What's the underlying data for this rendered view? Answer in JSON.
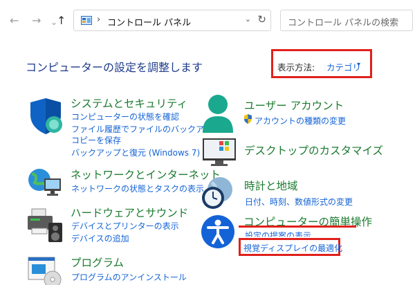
{
  "nav": {
    "back": "←",
    "forward": "→",
    "recent": "⌄",
    "up": "↑"
  },
  "address": {
    "chevron": "›",
    "path": "コントロール パネル",
    "dropdown": "⌄",
    "refresh": "↻"
  },
  "search": {
    "placeholder": "コントロール パネルの検索"
  },
  "heading": "コンピューターの設定を調整します",
  "view": {
    "label": "表示方法:",
    "value": "カテゴリ",
    "caret": "▾",
    "highlight_color": "#e0201b"
  },
  "left": [
    {
      "title": "システムとセキュリティ",
      "icon": "shield-icon",
      "links": [
        "コンピューターの状態を確認",
        "ファイル履歴でファイルのバックアップ",
        "コピーを保存",
        "バックアップと復元 (Windows 7)"
      ]
    },
    {
      "title": "ネットワークとインターネット",
      "icon": "network-globe-icon",
      "links": [
        "ネットワークの状態とタスクの表示"
      ]
    },
    {
      "title": "ハードウェアとサウンド",
      "icon": "printer-speaker-icon",
      "links": [
        "デバイスとプリンターの表示",
        "デバイスの追加"
      ]
    },
    {
      "title": "プログラム",
      "icon": "programs-disc-icon",
      "links": [
        "プログラムのアンインストール"
      ]
    }
  ],
  "right": [
    {
      "title": "ユーザー アカウント",
      "icon": "user-account-icon",
      "links": [
        "アカウントの種類の変更"
      ]
    },
    {
      "title": "デスクトップのカスタマイズ",
      "icon": "desktop-monitor-icon",
      "links": []
    },
    {
      "title": "時計と地域",
      "icon": "clock-globe-icon",
      "links": [
        "日付、時刻、数値形式の変更"
      ]
    },
    {
      "title": "コンピューターの簡単操作",
      "icon": "accessibility-icon",
      "links": [
        "設定の提案の表示",
        "視覚ディスプレイの最適化"
      ]
    }
  ],
  "colors": {
    "category_title": "#1a7a2e",
    "link": "#1463d6",
    "heading": "#1e3a8a",
    "annotation": "#e0201b"
  }
}
